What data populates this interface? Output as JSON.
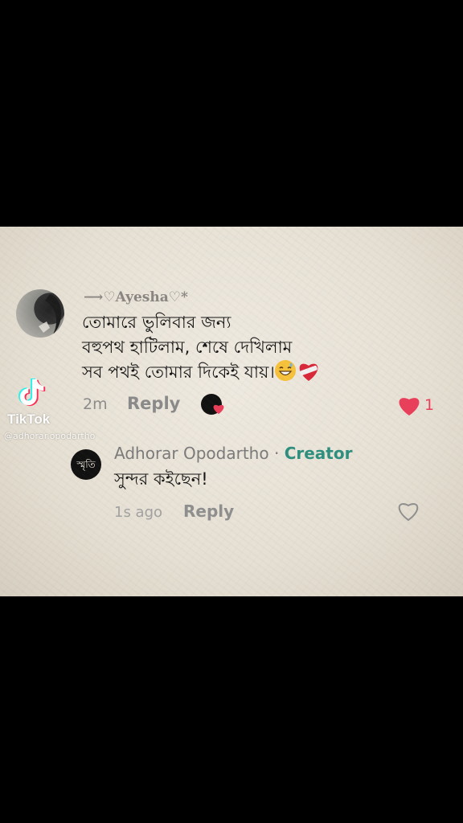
{
  "comment": {
    "username": "⟶♡Ayesha♡*",
    "text": "তোমারে ভুলিবার জন্য\nবহুপথ হাটিলাম, শেষে দেখিলাম\nসব পথই তোমার দিকেই যায়।",
    "time": "2m",
    "reply_label": "Reply",
    "like_count": "1",
    "liked": true,
    "colors": {
      "heart": "#ea3f5a",
      "username": "#8b8682"
    }
  },
  "watermark": {
    "brand": "TikTok",
    "handle": "@adhorar.opodartho"
  },
  "reply": {
    "author": "Adhorar Opodartho",
    "separator": " · ",
    "badge": "Creator",
    "avatar_text": "স্মৃতি",
    "text": "সুন্দর কইছেন!",
    "time": "1s ago",
    "reply_label": "Reply",
    "liked": false,
    "colors": {
      "badge": "#2e8f7f"
    }
  }
}
